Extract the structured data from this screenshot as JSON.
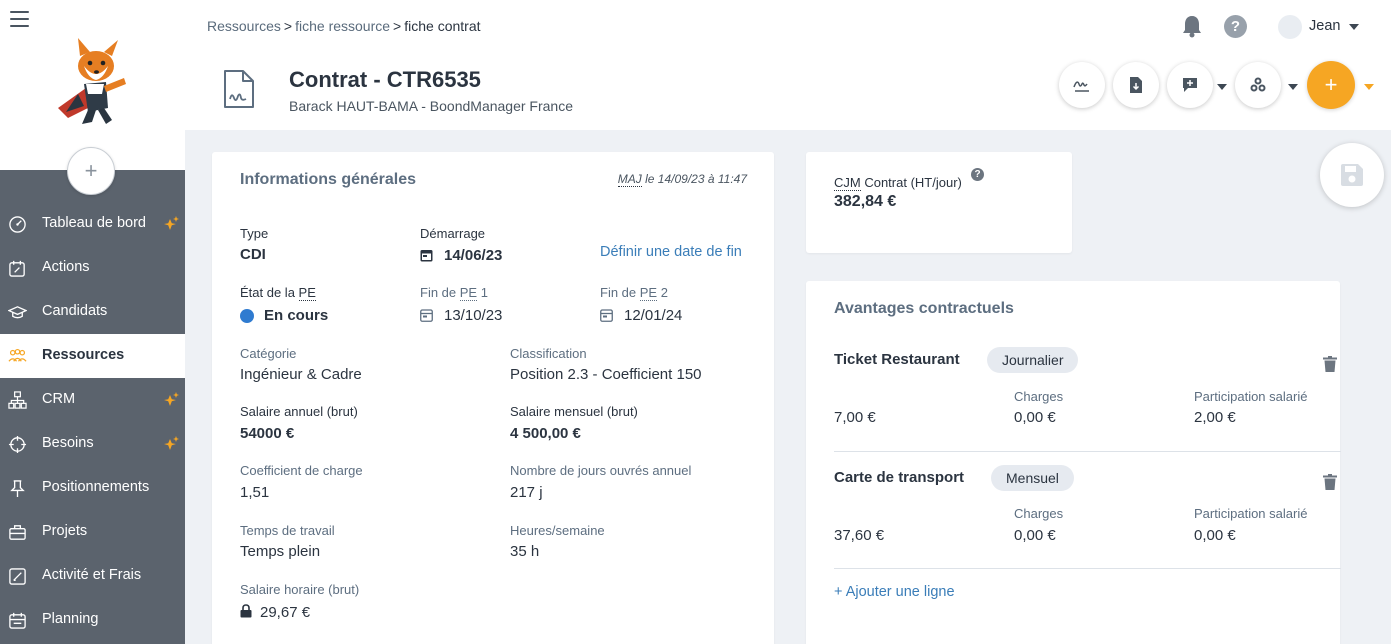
{
  "sidebar": {
    "add_symbol": "+",
    "items": [
      {
        "label": "Tableau de bord",
        "icon": "dashboard-icon",
        "star": true,
        "active": false
      },
      {
        "label": "Actions",
        "icon": "calendar-edit-icon",
        "star": false,
        "active": false
      },
      {
        "label": "Candidats",
        "icon": "graduation-cap-icon",
        "star": false,
        "active": false
      },
      {
        "label": "Ressources",
        "icon": "people-icon",
        "star": false,
        "active": true
      },
      {
        "label": "CRM",
        "icon": "org-chart-icon",
        "star": true,
        "active": false
      },
      {
        "label": "Besoins",
        "icon": "crosshair-icon",
        "star": true,
        "active": false
      },
      {
        "label": "Positionnements",
        "icon": "pin-icon",
        "star": false,
        "active": false
      },
      {
        "label": "Projets",
        "icon": "briefcase-icon",
        "star": false,
        "active": false
      },
      {
        "label": "Activité et Frais",
        "icon": "edit-square-icon",
        "star": false,
        "active": false
      },
      {
        "label": "Planning",
        "icon": "calendar-icon",
        "star": false,
        "active": false
      }
    ]
  },
  "header": {
    "breadcrumb": [
      "Ressources",
      "fiche ressource",
      "fiche contrat"
    ],
    "breadcrumb_sep": ">",
    "help_symbol": "?",
    "user_name": "Jean",
    "title": "Contrat - CTR6535",
    "subtitle": "Barack HAUT-BAMA - BoondManager France",
    "plus_symbol": "+"
  },
  "general": {
    "title": "Informations générales",
    "maj": {
      "abbr": "MAJ",
      "text": " le 14/09/23 à 11:47"
    },
    "type": {
      "label": "Type",
      "value": "CDI"
    },
    "start": {
      "label": "Démarrage",
      "value": "14/06/23"
    },
    "end_link": "Définir une date de fin",
    "pe_state": {
      "label_prefix": "État de la ",
      "abbr": "PE",
      "value": "En cours"
    },
    "pe_end1": {
      "label_prefix": "Fin de ",
      "abbr": "PE",
      "label_suffix": " 1",
      "value": "13/10/23"
    },
    "pe_end2": {
      "label_prefix": "Fin de ",
      "abbr": "PE",
      "label_suffix": " 2",
      "value": "12/01/24"
    },
    "category": {
      "label": "Catégorie",
      "value": "Ingénieur & Cadre"
    },
    "classification": {
      "label": "Classification",
      "value": "Position 2.3 - Coefficient 150"
    },
    "annual_salary": {
      "label": "Salaire annuel (brut)",
      "value": "54000 €"
    },
    "monthly_salary": {
      "label": "Salaire mensuel (brut)",
      "value": "4 500,00 €"
    },
    "charge_coef": {
      "label": "Coefficient de charge",
      "value": "1,51"
    },
    "working_days": {
      "label": "Nombre de jours ouvrés annuel",
      "value": "217 j"
    },
    "work_time": {
      "label": "Temps de travail",
      "value": "Temps plein"
    },
    "hours_week": {
      "label": "Heures/semaine",
      "value": "35 h"
    },
    "hourly_salary": {
      "label": "Salaire horaire (brut)",
      "value": "29,67 €"
    }
  },
  "cjm": {
    "label_abbr": "CJM",
    "label_rest": " Contrat (HT/jour)",
    "help_symbol": "?",
    "value": "382,84 €"
  },
  "advantages": {
    "title": "Avantages contractuels",
    "rows": [
      {
        "name": "Ticket Restaurant",
        "frequency": "Journalier",
        "amount": "7,00 €",
        "charges_label": "Charges",
        "charges": "0,00 €",
        "participation_label": "Participation salarié",
        "participation": "2,00 €"
      },
      {
        "name": "Carte de transport",
        "frequency": "Mensuel",
        "amount": "37,60 €",
        "charges_label": "Charges",
        "charges": "0,00 €",
        "participation_label": "Participation salarié",
        "participation": "0,00 €"
      }
    ],
    "add_line": "+ Ajouter une ligne"
  },
  "colors": {
    "sidebar_bg": "#5b636d",
    "accent_orange": "#f6a623",
    "link_blue": "#3a7db8",
    "status_blue": "#2f7bd0",
    "star_orange": "#f6a623"
  }
}
